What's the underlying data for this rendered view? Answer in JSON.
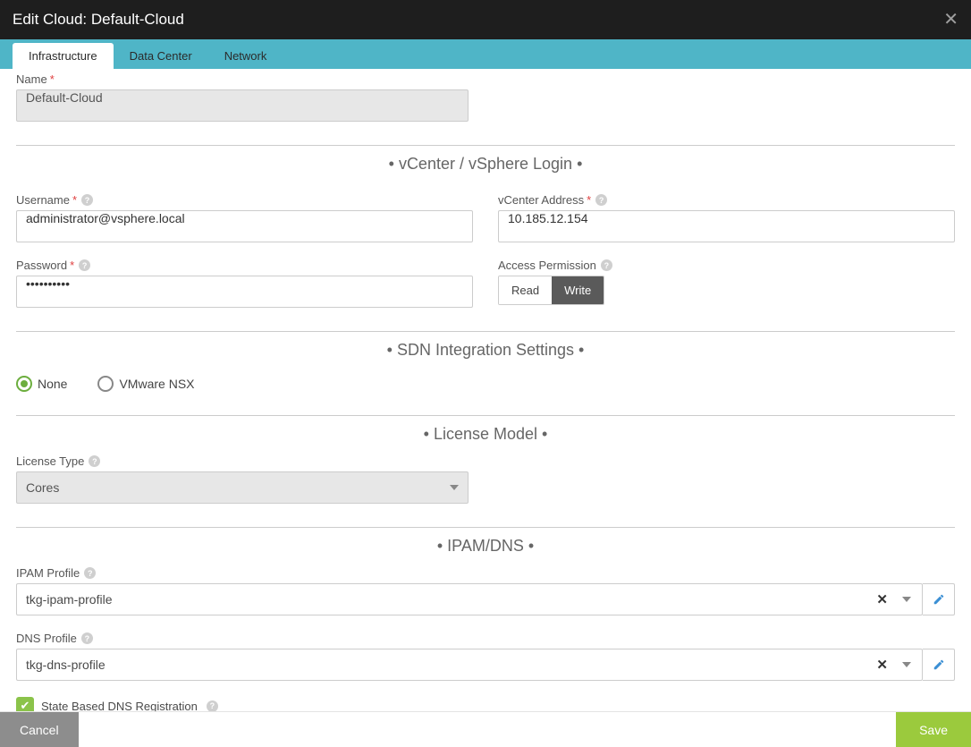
{
  "header": {
    "title": "Edit Cloud: Default-Cloud"
  },
  "tabs": [
    {
      "label": "Infrastructure",
      "active": true
    },
    {
      "label": "Data Center",
      "active": false
    },
    {
      "label": "Network",
      "active": false
    }
  ],
  "name": {
    "label": "Name",
    "value": "Default-Cloud"
  },
  "sections": {
    "login": "vCenter / vSphere Login",
    "sdn": "SDN Integration Settings",
    "license": "License Model",
    "ipam": "IPAM/DNS"
  },
  "login": {
    "username_label": "Username",
    "username_value": "administrator@vsphere.local",
    "vcenter_label": "vCenter Address",
    "vcenter_value": "10.185.12.154",
    "password_label": "Password",
    "password_value": "••••••••••",
    "access_label": "Access Permission",
    "access_read": "Read",
    "access_write": "Write"
  },
  "sdn": {
    "none": "None",
    "nsx": "VMware NSX"
  },
  "license": {
    "type_label": "License Type",
    "type_value": "Cores"
  },
  "ipam": {
    "ipam_label": "IPAM Profile",
    "ipam_value": "tkg-ipam-profile",
    "dns_label": "DNS Profile",
    "dns_value": "tkg-dns-profile",
    "state_label": "State Based DNS Registration"
  },
  "footer": {
    "cancel": "Cancel",
    "save": "Save"
  }
}
